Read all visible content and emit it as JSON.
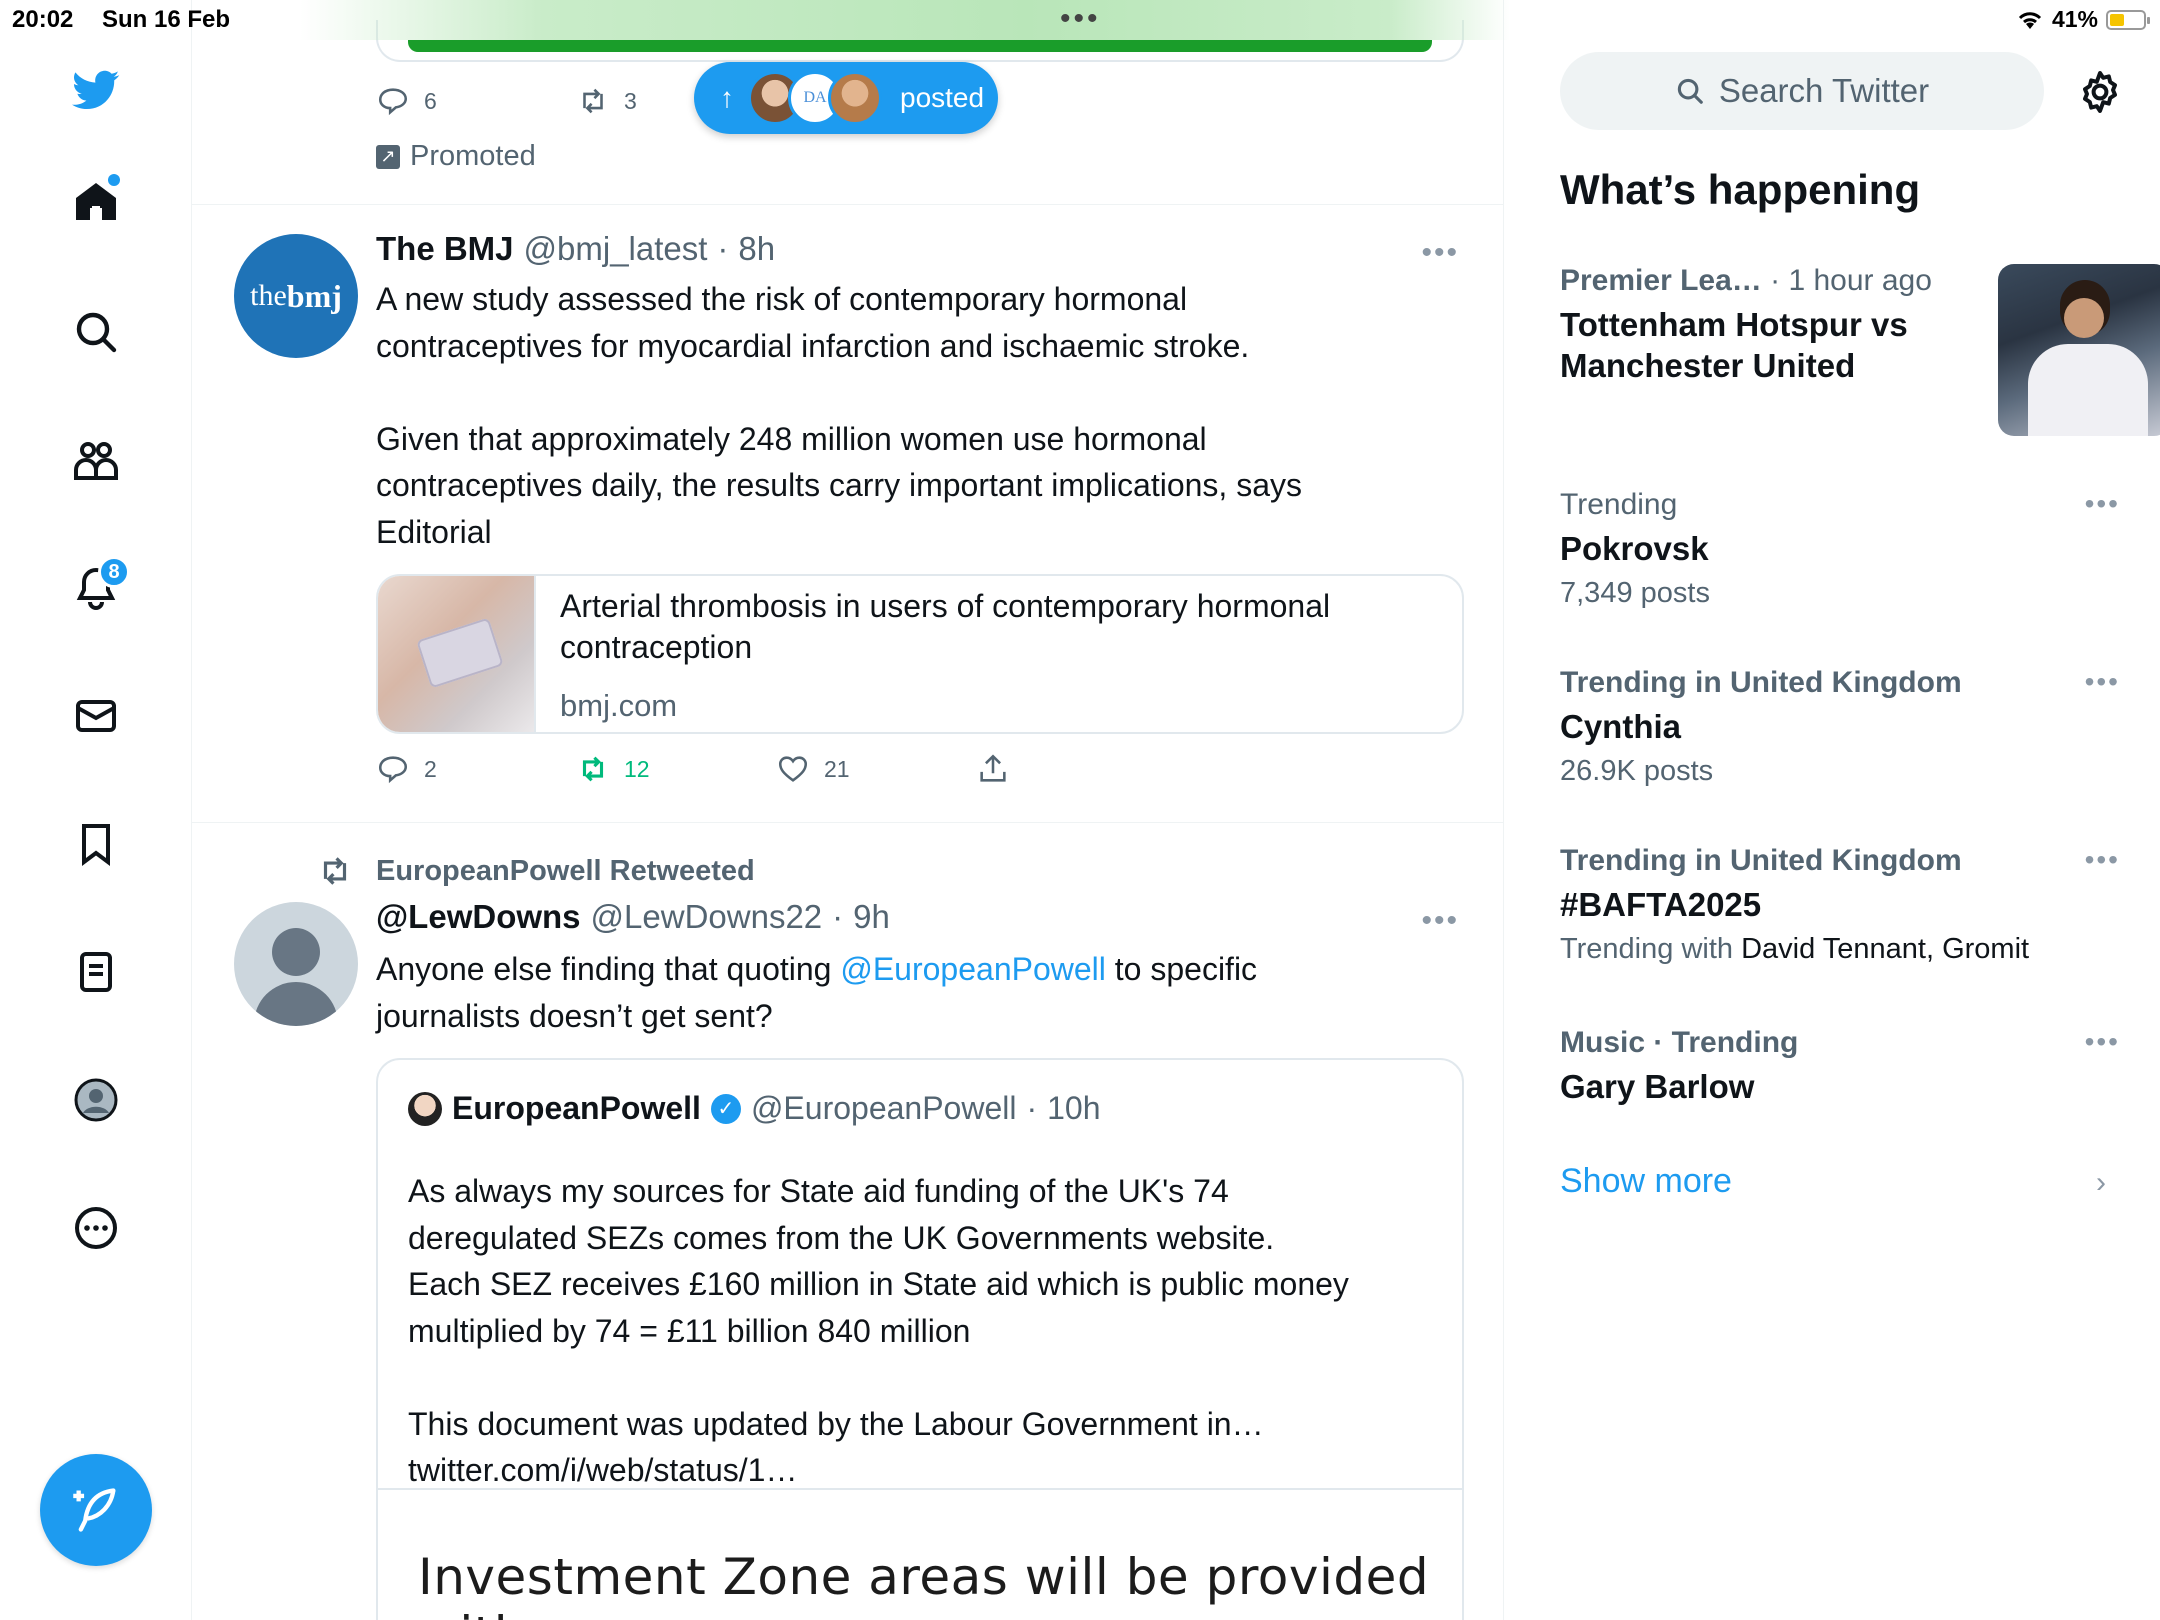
{
  "status_bar": {
    "time": "20:02",
    "date": "Sun 16 Feb",
    "battery": "41%"
  },
  "sidebar": {
    "notifications_badge": "8"
  },
  "top_tweet": {
    "replies": "6",
    "retweets": "3",
    "promoted_label": "Promoted"
  },
  "posted_pill": {
    "label": "posted"
  },
  "bmj_tweet": {
    "name": "The BMJ",
    "handle": "@bmj_latest",
    "time": "8h",
    "avatar_text_light": "the",
    "avatar_text_bold": "bmj",
    "text": "A new study assessed the risk of contemporary hormonal\ncontraceptives for myocardial infarction and ischaemic stroke.\n\nGiven that approximately 248 million women use hormonal\ncontraceptives daily, the results carry important implications, says\nEditorial",
    "card_title": "Arterial thrombosis in users of contemporary hormonal contraception",
    "card_domain": "bmj.com",
    "replies": "2",
    "retweets": "12",
    "likes": "21"
  },
  "retweet_tweet": {
    "retweeted_by": "EuropeanPowell Retweeted",
    "name": "@LewDowns",
    "handle": "@LewDowns22",
    "time": "9h",
    "text_before": "Anyone else finding that quoting ",
    "mention": "@EuropeanPowell",
    "text_after": " to specific\njournalists doesn’t get sent?",
    "quote": {
      "name": "EuropeanPowell",
      "handle": "@EuropeanPowell",
      "time": "10h",
      "text": "As always my sources for State aid funding of the UK's 74\nderegulated SEZs comes from the UK Governments website.\nEach SEZ receives £160 million in State aid which is public money\nmultiplied by 74 = £11 billion 840 million\n\nThis document was updated by the Labour Government in…\ntwitter.com/i/web/status/1…",
      "image_text": "Investment Zone areas will be provided with"
    }
  },
  "right_panel": {
    "search_placeholder": "Search Twitter",
    "section_title": "What’s happening",
    "news": {
      "category": "Premier Lea…",
      "time": "· 1 hour ago",
      "title": "Tottenham Hotspur vs\nManchester United"
    },
    "trends": [
      {
        "meta": "Trending",
        "title": "Pokrovsk",
        "count": "7,349 posts"
      },
      {
        "meta": "Trending in United Kingdom",
        "title": "Cynthia",
        "count": "26.9K posts"
      },
      {
        "meta": "Trending in United Kingdom",
        "title": "#BAFTA2025",
        "with_label": "Trending with",
        "with_names": "David Tennant, Gromit"
      },
      {
        "meta": "Music · Trending",
        "title": "Gary Barlow"
      }
    ],
    "show_more": "Show more"
  },
  "colors": {
    "accent": "#1d9bf0",
    "retweet_green": "#00ba7c",
    "secondary_text": "#536471"
  }
}
